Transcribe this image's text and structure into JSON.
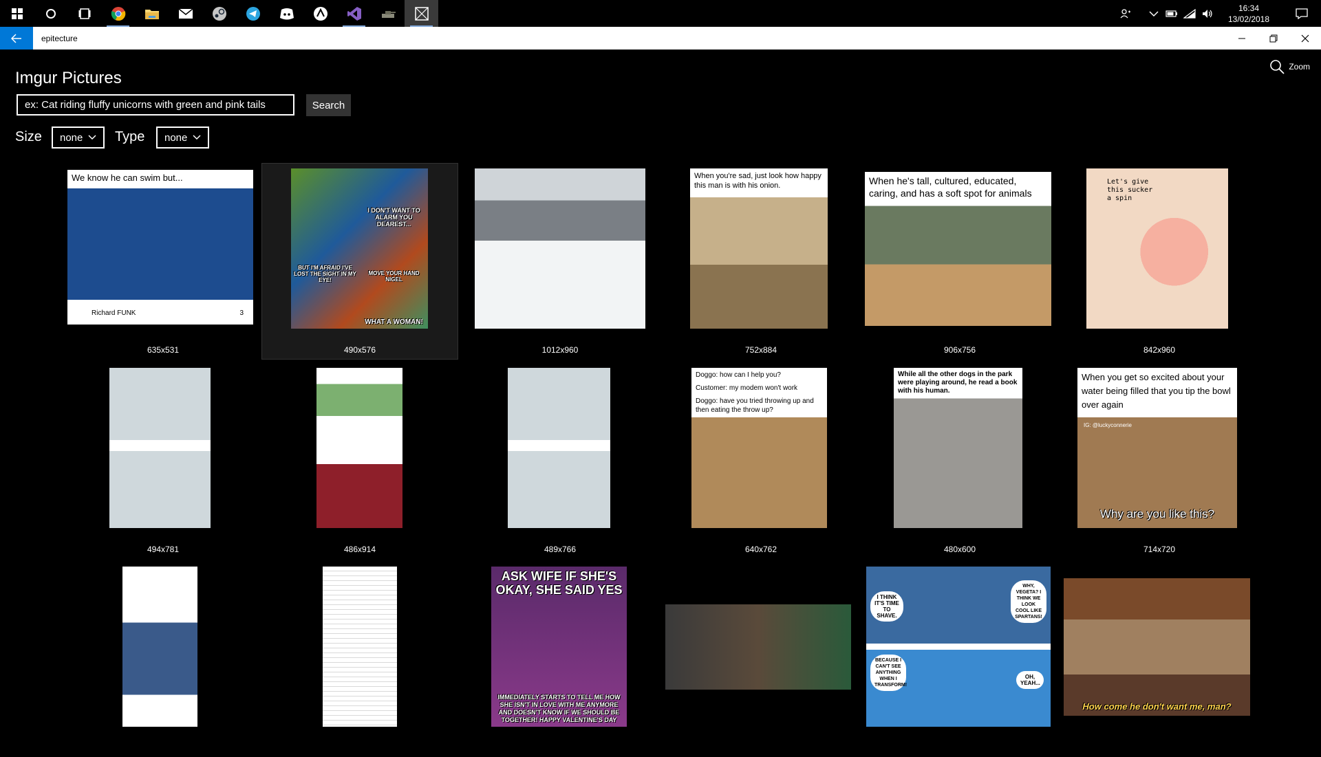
{
  "taskbar": {
    "apps": [
      {
        "name": "windows-start",
        "icon": "windows-icon"
      },
      {
        "name": "cortana",
        "icon": "search-circle-icon"
      },
      {
        "name": "task-view",
        "icon": "task-view-icon"
      },
      {
        "name": "chrome",
        "icon": "chrome-icon"
      },
      {
        "name": "file-explorer",
        "icon": "folder-icon"
      },
      {
        "name": "mail",
        "icon": "mail-icon"
      },
      {
        "name": "steam",
        "icon": "steam-icon"
      },
      {
        "name": "telegram",
        "icon": "telegram-icon"
      },
      {
        "name": "discord",
        "icon": "discord-icon"
      },
      {
        "name": "osu",
        "icon": "osu-icon"
      },
      {
        "name": "visual-studio",
        "icon": "visual-studio-icon"
      },
      {
        "name": "game",
        "icon": "tank-icon"
      },
      {
        "name": "epitecture",
        "icon": "app-x-icon"
      }
    ],
    "clock": {
      "time": "16:34",
      "date": "13/02/2018"
    }
  },
  "titlebar": {
    "title": "epitecture"
  },
  "header": {
    "title": "Imgur Pictures",
    "zoom_label": "Zoom"
  },
  "search": {
    "placeholder": "ex: Cat riding fluffy unicorns with green and pink tails",
    "button_label": "Search"
  },
  "filters": {
    "size_label": "Size",
    "size_value": "none",
    "type_label": "Type",
    "type_value": "none"
  },
  "images": [
    {
      "dims": "635x531",
      "caption": "We know he can swim but...",
      "subtext": "Richard FUNK",
      "score": "3"
    },
    {
      "dims": "490x576",
      "caption_top": "I DON'T WANT TO ALARM YOU DEAREST...",
      "caption_mid": "BUT I'M AFRAID I'VE LOST THE SIGHT IN MY EYE!",
      "caption_mid2": "MOVE YOUR HAND NIGEL",
      "caption_bottom": "WHAT A WOMAN!"
    },
    {
      "dims": "1012x960"
    },
    {
      "dims": "752x884",
      "caption": "When you're sad, just look how happy this man is with his onion."
    },
    {
      "dims": "906x756",
      "caption": "When he's tall, cultured, educated, caring, and has a soft spot for animals"
    },
    {
      "dims": "842x960",
      "caption": "Let's give this sucker a spin"
    },
    {
      "dims": "494x781"
    },
    {
      "dims": "486x914"
    },
    {
      "dims": "489x766"
    },
    {
      "dims": "640x762",
      "caption_1": "Doggo: how can I help you?",
      "caption_2": "Customer: my modem won't work",
      "caption_3": "Doggo: have you tried throwing up and then eating the throw up?"
    },
    {
      "dims": "480x600",
      "caption": "While all the other dogs in the park were playing around, he read a book with his human."
    },
    {
      "dims": "714x720",
      "caption": "When you get so excited about your water being filled that you tip the bowl over again",
      "bottom": "Why are you like this?",
      "handle": "IG: @luckyconnerie"
    },
    {
      "dims": ""
    },
    {
      "dims": ""
    },
    {
      "dims": "",
      "top": "ASK WIFE IF SHE'S OKAY, SHE SAID YES",
      "bottom": "IMMEDIATELY STARTS TO TELL ME HOW SHE ISN'T IN LOVE WITH ME ANYMORE AND DOESN'T KNOW IF WE SHOULD BE TOGETHER! HAPPY VALENTINE'S DAY"
    },
    {
      "dims": ""
    },
    {
      "dims": "",
      "bubble_1": "I THINK IT'S TIME TO SHAVE.",
      "bubble_2": "WHY, VEGETA? I THINK WE LOOK COOL LIKE SPARTANS!",
      "bubble_3": "BECAUSE I CAN'T SEE ANYTHING WHEN I TRANSFORM!",
      "bubble_4": "OH, YEAH..."
    },
    {
      "dims": "",
      "caption": "How come he don't want me, man?"
    }
  ],
  "colors": {
    "accent": "#0078d7",
    "background": "#000000",
    "button": "#333333"
  }
}
